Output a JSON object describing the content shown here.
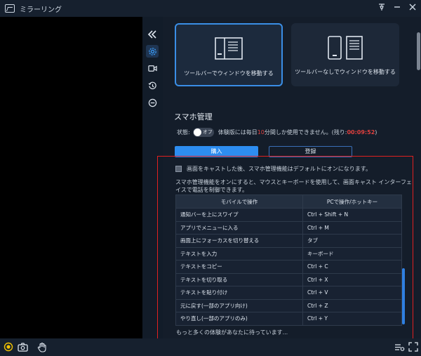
{
  "app": {
    "title": "ミラーリング"
  },
  "modes": [
    {
      "label": "ツールバーでウィンドウを移動する",
      "active": true
    },
    {
      "label": "ツールバーなしでウィンドウを移動する",
      "active": false
    }
  ],
  "manage": {
    "title": "スマホ管理",
    "status_label": "状態:",
    "toggle_text": "オフ",
    "trial_prefix": "体験版には毎日",
    "trial_minutes": "10",
    "trial_suffix": "分間しか使用できません。(残り:",
    "remaining": "00:09:52",
    "close_paren": ")"
  },
  "buttons": {
    "buy": "購入",
    "register": "登録"
  },
  "checkbox_label": "画面をキャストした後、スマホ管理機能はデフォルトにオンになります。",
  "description": "スマホ管理機能をオンにすると、マウスとキーボードを使用して、画面キャスト インターフェイスで電話を制御できます。",
  "table": {
    "headers": [
      "モバイルで操作",
      "PCで操作/ホットキー"
    ],
    "rows": [
      [
        "通知バーを上にスワイプ",
        "Ctrl + Shift + N"
      ],
      [
        "アプリでメニューに入る",
        "Ctrl + M"
      ],
      [
        "画面上にフォーカスを切り替える",
        "タブ"
      ],
      [
        "テキストを入力",
        "キーボード"
      ],
      [
        "テキストをコピー",
        "Ctrl + C"
      ],
      [
        "テキストを切り取る",
        "Ctrl + X"
      ],
      [
        "テキストを貼り付け",
        "Ctrl + V"
      ],
      [
        "元に戻す(一部のアプリ向け)",
        "Ctrl + Z"
      ],
      [
        "やり直し(一部のアプリのみ)",
        "Ctrl + Y"
      ]
    ]
  },
  "more_text": "もっと多くの体験があなたに待っています...",
  "icons": {
    "titlebar": [
      "pin-icon",
      "minimize-icon",
      "close-icon"
    ],
    "strip": [
      "collapse-icon",
      "settings-icon",
      "record-icon",
      "history-icon",
      "minus-circle-icon"
    ],
    "bottom": [
      "record-dot-icon",
      "camera-icon",
      "hand-icon",
      "settings-list-icon",
      "fullscreen-icon"
    ]
  },
  "colors": {
    "accent": "#2d8df0",
    "remaining": "#e0403e",
    "highlight_box": "#e02020"
  }
}
